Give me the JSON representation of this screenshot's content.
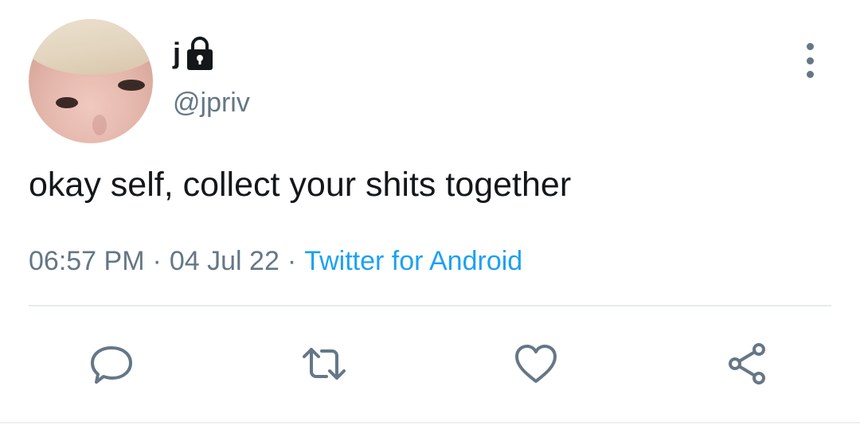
{
  "user": {
    "display_name": "j",
    "handle": "@jpriv",
    "protected_icon": "lock-icon",
    "avatar_icon": "profile-photo"
  },
  "tweet": {
    "text": "okay self, collect your shits together",
    "time": "06:57 PM",
    "date": "04 Jul 22",
    "separator": "·",
    "source": "Twitter for Android"
  },
  "actions": {
    "reply_icon": "reply-icon",
    "retweet_icon": "retweet-icon",
    "like_icon": "heart-icon",
    "share_icon": "share-icon",
    "more_icon": "more-vertical-icon"
  },
  "colors": {
    "text": "#14171a",
    "secondary": "#657786",
    "link": "#1da1f2",
    "divider": "#e6ecf0"
  }
}
